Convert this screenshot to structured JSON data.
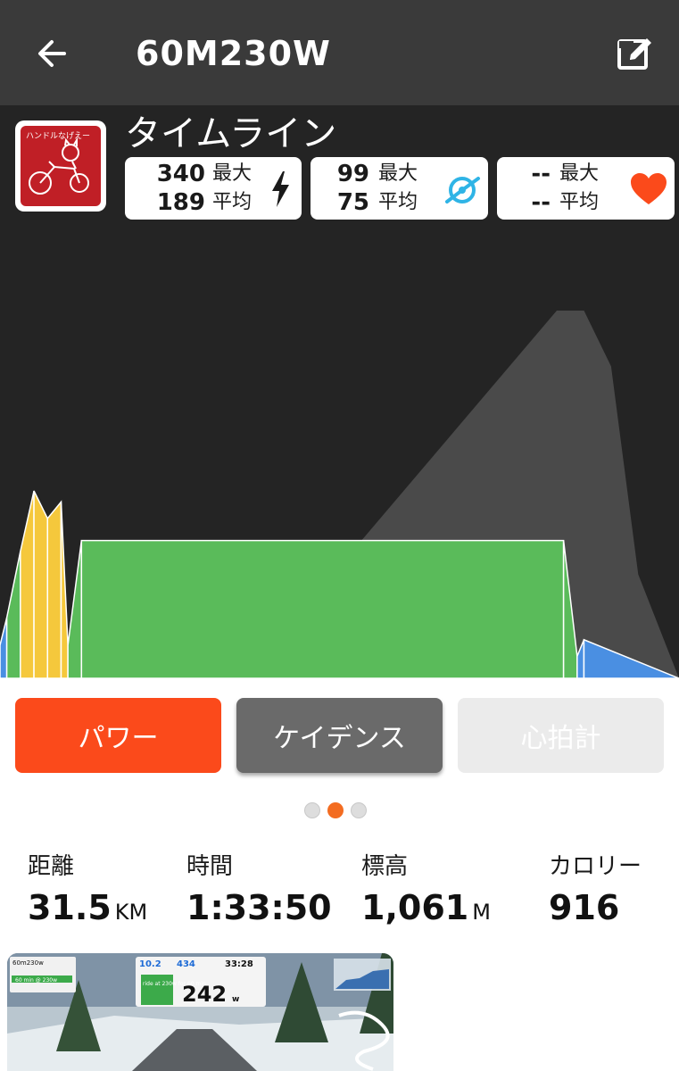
{
  "header": {
    "title": "60M230W"
  },
  "panel": {
    "timeline_label": "タイムライン",
    "avatar_text": "ハンドルなげえー"
  },
  "stats": {
    "power": {
      "max": "340",
      "avg": "189",
      "max_label": "最大",
      "avg_label": "平均"
    },
    "cadence": {
      "max": "99",
      "avg": "75",
      "max_label": "最大",
      "avg_label": "平均"
    },
    "heart_rate": {
      "max": "--",
      "avg": "--",
      "max_label": "最大",
      "avg_label": "平均"
    }
  },
  "tabs": {
    "power": "パワー",
    "cadence": "ケイデンス",
    "heart_rate": "心拍計"
  },
  "pagination": {
    "total": 3,
    "active": 2
  },
  "metrics": {
    "distance": {
      "label": "距離",
      "value": "31.5",
      "unit": "KM"
    },
    "time": {
      "label": "時間",
      "value": "1:33:50",
      "unit": ""
    },
    "elevation": {
      "label": "標高",
      "value": "1,061",
      "unit": "M"
    },
    "calories": {
      "label": "カロリー",
      "value": "916",
      "unit": ""
    }
  },
  "thumbnail": {
    "workout": "60m230w",
    "hud_distance": "10.2",
    "hud_elev": "434",
    "hud_time": "33:28",
    "hud_power": "242",
    "hud_power_unit": "w",
    "step_text": "60 min @ 230w",
    "step_detail": "ride at 230w for 60 min"
  },
  "colors": {
    "accent": "#fb4a1b",
    "zone_blue": "#4a8fe2",
    "zone_green": "#5abb5a",
    "zone_yellow": "#f5c83c",
    "elevation_fill": "#4a4a4a"
  },
  "chart_data": {
    "type": "area",
    "description_series": "power zones over ride time with elevation profile backdrop",
    "series": [
      {
        "name": "elevation",
        "x": [
          0,
          0.36,
          0.82,
          0.86,
          0.9,
          0.94,
          1.0
        ],
        "values": [
          0,
          0,
          1061,
          1061,
          900,
          300,
          0
        ]
      },
      {
        "name": "power",
        "x": [
          0,
          0.01,
          0.03,
          0.05,
          0.07,
          0.09,
          0.1,
          0.12,
          0.83,
          0.85,
          0.86,
          1.0
        ],
        "values": [
          60,
          110,
          230,
          340,
          290,
          320,
          60,
          250,
          250,
          40,
          70,
          0
        ]
      }
    ],
    "ylim": [
      0,
      340
    ]
  }
}
